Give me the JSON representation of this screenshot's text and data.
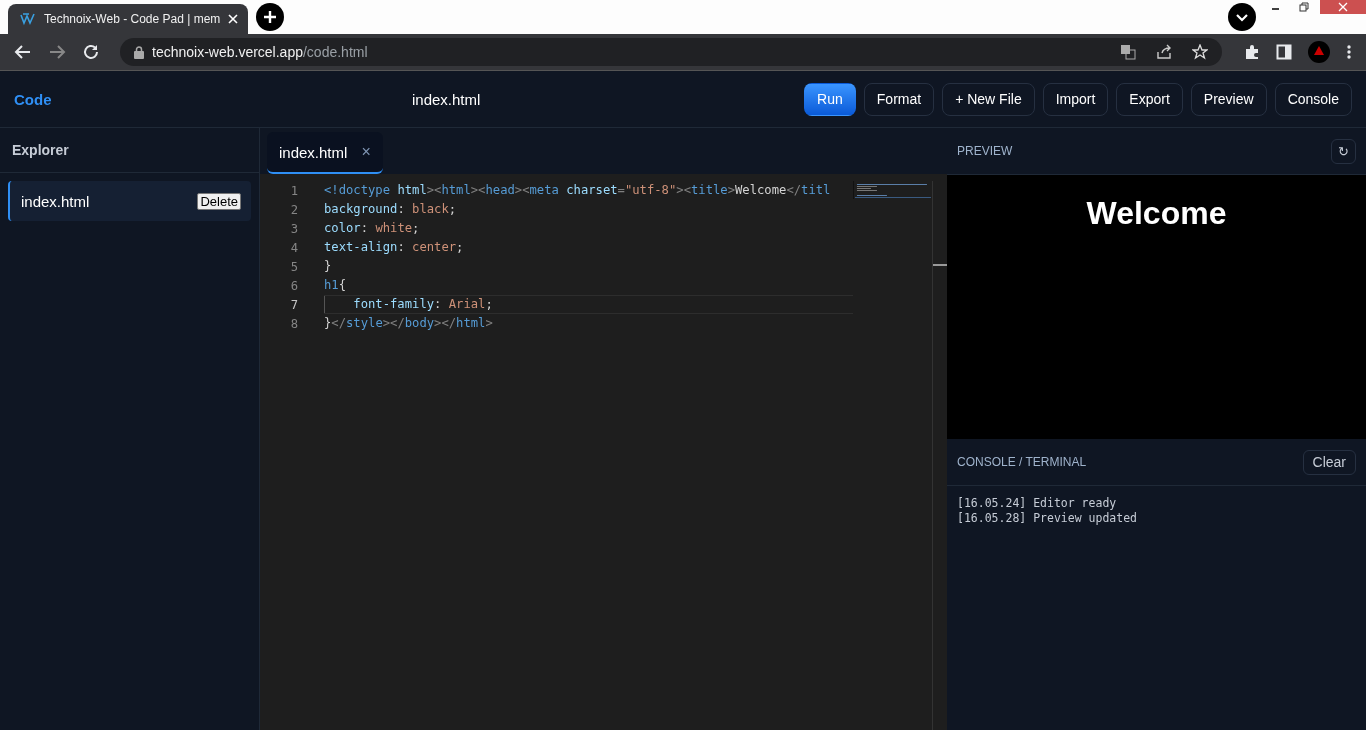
{
  "browser": {
    "tab_title": "Technoix-Web - Code Pad | mem",
    "url_host": "technoix-web.vercel.app",
    "url_path": "/code.html"
  },
  "header": {
    "logo": "Code",
    "file_name": "index.html",
    "buttons": [
      {
        "label": "Run",
        "kind": "primary"
      },
      {
        "label": "Format",
        "kind": "plain"
      },
      {
        "label": "+ New File",
        "kind": "plain"
      },
      {
        "label": "Import",
        "kind": "plain"
      },
      {
        "label": "Export",
        "kind": "plain"
      },
      {
        "label": "Preview",
        "kind": "plain"
      },
      {
        "label": "Console",
        "kind": "plain"
      }
    ]
  },
  "sidebar": {
    "title": "Explorer",
    "items": [
      {
        "name": "index.html",
        "action": "Delete",
        "selected": true
      }
    ]
  },
  "editor": {
    "tabs": [
      {
        "label": "index.html",
        "close": "×",
        "selected": true
      }
    ],
    "lines": [
      {
        "number": "1",
        "current": false,
        "tokens": [
          {
            "kind": "tag",
            "text": "<!doctype"
          },
          {
            "kind": "attr",
            "text": " html"
          },
          {
            "kind": "punct",
            "text": "><"
          },
          {
            "kind": "tag",
            "text": "html"
          },
          {
            "kind": "punct",
            "text": "><"
          },
          {
            "kind": "tag",
            "text": "head"
          },
          {
            "kind": "punct",
            "text": "><"
          },
          {
            "kind": "tag",
            "text": "meta"
          },
          {
            "kind": "attr",
            "text": " charset"
          },
          {
            "kind": "punct",
            "text": "="
          },
          {
            "kind": "string",
            "text": "\"utf-8\""
          },
          {
            "kind": "punct",
            "text": "><"
          },
          {
            "kind": "tag",
            "text": "title"
          },
          {
            "kind": "punct",
            "text": ">"
          },
          {
            "kind": "text",
            "text": "Welcome"
          },
          {
            "kind": "punct",
            "text": "</"
          },
          {
            "kind": "tag",
            "text": "titl"
          }
        ]
      },
      {
        "number": "2",
        "current": false,
        "tokens": [
          {
            "kind": "prop",
            "text": "background"
          },
          {
            "kind": "text",
            "text": ": "
          },
          {
            "kind": "string",
            "text": "black"
          },
          {
            "kind": "text",
            "text": ";"
          }
        ]
      },
      {
        "number": "3",
        "current": false,
        "tokens": [
          {
            "kind": "prop",
            "text": "color"
          },
          {
            "kind": "text",
            "text": ": "
          },
          {
            "kind": "string",
            "text": "white"
          },
          {
            "kind": "text",
            "text": ";"
          }
        ]
      },
      {
        "number": "4",
        "current": false,
        "tokens": [
          {
            "kind": "prop",
            "text": "text-align"
          },
          {
            "kind": "text",
            "text": ": "
          },
          {
            "kind": "string",
            "text": "center"
          },
          {
            "kind": "text",
            "text": ";"
          }
        ]
      },
      {
        "number": "5",
        "current": false,
        "tokens": [
          {
            "kind": "text",
            "text": "}"
          }
        ]
      },
      {
        "number": "6",
        "current": false,
        "tokens": [
          {
            "kind": "tag",
            "text": "h1"
          },
          {
            "kind": "text",
            "text": "{"
          }
        ]
      },
      {
        "number": "7",
        "current": true,
        "tokens": [
          {
            "kind": "prop",
            "text": "    font-family"
          },
          {
            "kind": "text",
            "text": ": "
          },
          {
            "kind": "string",
            "text": "Arial"
          },
          {
            "kind": "text",
            "text": ";"
          }
        ]
      },
      {
        "number": "8",
        "current": false,
        "tokens": [
          {
            "kind": "text",
            "text": "}"
          },
          {
            "kind": "punct",
            "text": "</"
          },
          {
            "kind": "tag",
            "text": "style"
          },
          {
            "kind": "punct",
            "text": "></"
          },
          {
            "kind": "tag",
            "text": "body"
          },
          {
            "kind": "punct",
            "text": "></"
          },
          {
            "kind": "tag",
            "text": "html"
          },
          {
            "kind": "punct",
            "text": ">"
          }
        ]
      }
    ]
  },
  "preview": {
    "title": "PREVIEW",
    "refresh": "↻",
    "heading": "Welcome"
  },
  "console": {
    "title": "CONSOLE / TERMINAL",
    "clear": "Clear",
    "logs": [
      "[16.05.24] Editor ready",
      "[16.05.28] Preview updated"
    ]
  }
}
